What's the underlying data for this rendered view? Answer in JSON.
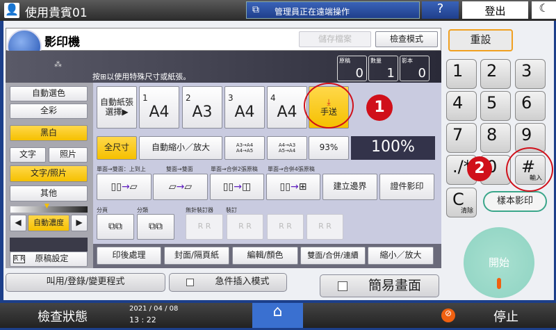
{
  "topbar": {
    "user": "使用貴賓01",
    "remote": "管理員正在遠端操作",
    "help": "?",
    "logout": "登出"
  },
  "copier": {
    "title": "影印機",
    "save_file": "儲存檔案",
    "check_mode": "檢查模式",
    "hint": "按⊞以使用特殊尺寸或紙張。",
    "counters": [
      {
        "label": "原稿",
        "value": "0"
      },
      {
        "label": "數量",
        "value": "1"
      },
      {
        "label": "影本",
        "value": "0"
      }
    ]
  },
  "color": [
    "自動選色",
    "全彩",
    "黑白"
  ],
  "color_selected": "黑白",
  "original_type": {
    "text": "文字",
    "photo": "照片",
    "text_photo": "文字/照片",
    "other": "其他"
  },
  "density": {
    "label": "自動濃度",
    "level_percent": 50
  },
  "original_settings": "原稿設定",
  "paper": {
    "auto": "自動紙張\n選擇▶",
    "trays": [
      {
        "n": "1",
        "size": "A4"
      },
      {
        "n": "2",
        "size": "A3"
      },
      {
        "n": "3",
        "size": "A4"
      },
      {
        "n": "4",
        "size": "A4"
      }
    ],
    "bypass": "手送"
  },
  "ratio": {
    "full": "全尺寸",
    "auto": "自動縮小／放大",
    "a3a4": "A3→A4\nA4→A5",
    "a4a3": "A4→A3\nA5→A4",
    "p93": "93%",
    "current": "100%"
  },
  "duplex_labels": [
    "單面→雙面：上到上",
    "雙面→雙面",
    "單面→合併2張原稿",
    "單面→合併4張原稿"
  ],
  "margin": "建立邊界",
  "id_copy": "證件影印",
  "sort_labels": [
    "分頁",
    "分類",
    "無針裝訂器",
    "裝訂"
  ],
  "tabs": [
    "印後處理",
    "封面/隔頁紙",
    "編輯/顏色",
    "雙面/合併/連續",
    "縮小／放大"
  ],
  "program": "叫用/登錄/變更程式",
  "interrupt": "急件插入模式",
  "simple": "簡易畫面",
  "keypad": {
    "reset": "重設",
    "keys": [
      "1",
      "2",
      "3",
      "4",
      "5",
      "6",
      "7",
      "8",
      "9",
      "./*",
      "0",
      "#"
    ],
    "enter": "輸入",
    "clear": "C",
    "clear_label": "清除",
    "sample": "樣本影印",
    "start": "開始"
  },
  "status": {
    "check": "檢查狀態",
    "date": "2021 / 04 / 08",
    "time": "13 : 22",
    "stop": "停止"
  },
  "annotations": [
    "1",
    "2"
  ],
  "colors": {
    "accent": "#f5c000",
    "annotation": "#d0101a",
    "frame": "#1c3f8a"
  }
}
